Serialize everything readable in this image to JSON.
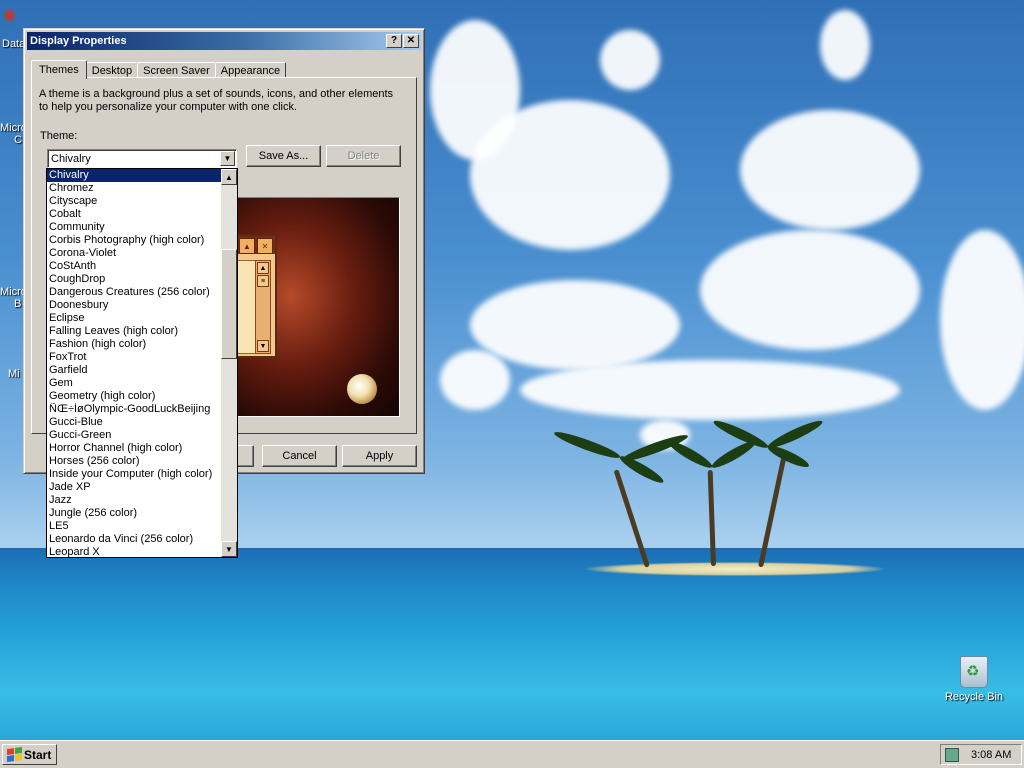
{
  "desktop": {
    "left_icon_clips": [
      "Data",
      "Micro",
      "C",
      "Micro",
      "B",
      "Mi"
    ],
    "recycle_bin_label": "Recycle Bin"
  },
  "taskbar": {
    "start_label": "Start",
    "clock": "3:08 AM"
  },
  "dialog": {
    "title": "Display Properties",
    "help_glyph": "?",
    "close_glyph": "✕",
    "tabs": [
      {
        "label": "Themes",
        "active": true
      },
      {
        "label": "Desktop",
        "active": false
      },
      {
        "label": "Screen Saver",
        "active": false
      },
      {
        "label": "Appearance",
        "active": false
      }
    ],
    "description": "A theme is a background plus a set of sounds, icons, and other elements to help you personalize your computer with one click.",
    "theme_label": "Theme:",
    "selected_theme": "Chivalry",
    "save_as_label": "Save As...",
    "delete_label": "Delete",
    "ok_label": "",
    "cancel_label": "Cancel",
    "apply_label": "Apply"
  },
  "theme_list": {
    "selected": "Chivalry",
    "items": [
      "Chivalry",
      "Chromez",
      "Cityscape",
      "Cobalt",
      "Community",
      "Corbis Photography (high color)",
      "Corona-Violet",
      "CoStAnth",
      "CoughDrop",
      "Dangerous Creatures (256 color)",
      "Doonesbury",
      "Eclipse",
      "Falling Leaves (high color)",
      "Fashion (high color)",
      "FoxTrot",
      "Garfield",
      "Gem",
      "Geometry (high color)",
      "ÑŒ÷ÍøOlympic-GoodLuckBeijing",
      "Gucci-Blue",
      "Gucci-Green",
      "Horror Channel (high color)",
      "Horses (256 color)",
      "Inside your Computer (high color)",
      "Jade XP",
      "Jazz",
      "Jungle (256 color)",
      "LE5",
      "Leonardo da Vinci (256 color)",
      "Leopard X"
    ]
  },
  "colors": {
    "title_bar": "#0a246a",
    "selection": "#0a246a",
    "face": "#d4d0c8"
  }
}
